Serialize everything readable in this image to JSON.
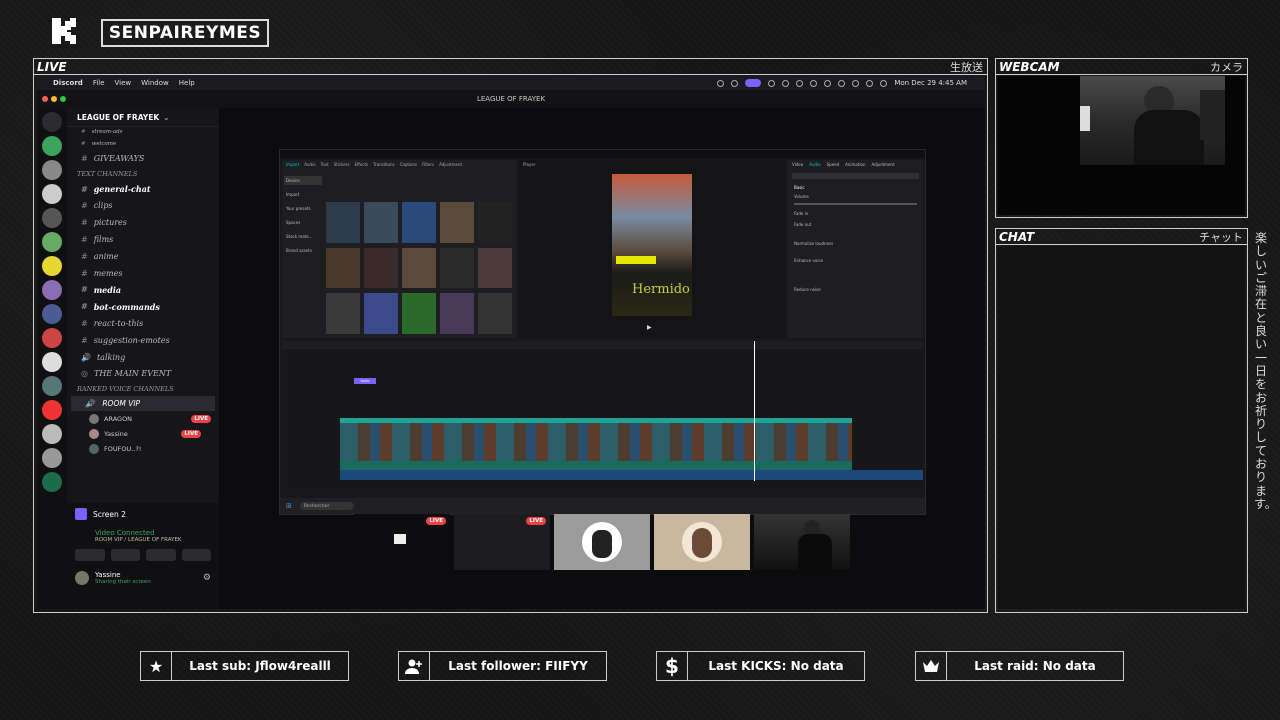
{
  "overlay": {
    "channel_name": "SENPAIREYMES",
    "live_label": "LIVE",
    "live_jp": "生放送",
    "webcam_label": "WEBCAM",
    "webcam_jp": "カメラ",
    "chat_label": "CHAT",
    "chat_jp": "チャット",
    "vertical_jp": "楽しいご滞在と良い一日をお祈りしております。"
  },
  "mac_menu": {
    "items": [
      "Discord",
      "File",
      "View",
      "Window",
      "Help"
    ],
    "clock": "Mon Dec 29  4:45 AM"
  },
  "discord": {
    "window_title": "LEAGUE OF FRAYEK",
    "server_name": "LEAGUE OF FRAYEK",
    "top_channels": [
      "stream-ads",
      "welcome",
      "GIVEAWAYS"
    ],
    "text_category": "TEXT CHANNELS",
    "text_channels": [
      {
        "name": "general-chat",
        "bold": true
      },
      {
        "name": "clips",
        "bold": false
      },
      {
        "name": "pictures",
        "bold": false
      },
      {
        "name": "films",
        "bold": false
      },
      {
        "name": "anime",
        "bold": false
      },
      {
        "name": "memes",
        "bold": false
      },
      {
        "name": "media",
        "bold": true
      },
      {
        "name": "bot-commands",
        "bold": true
      },
      {
        "name": "react-to-this",
        "bold": false
      },
      {
        "name": "suggestion-emotes",
        "bold": false
      },
      {
        "name": "talking",
        "bold": false
      },
      {
        "name": "THE MAIN EVENT",
        "bold": false
      }
    ],
    "voice_category": "RANKED VOICE CHANNELS",
    "voice_channel": "ROOM VIP",
    "voice_members": [
      {
        "name": "ARAGON",
        "live": true
      },
      {
        "name": "Yassine",
        "live": true
      },
      {
        "name": "FOUFOU..?!",
        "live": false
      }
    ],
    "live_badge": "LIVE",
    "screen_share_title": "Screen 2",
    "connection_status": "Video Connected",
    "connection_location": "ROOM VIP / LEAGUE OF FRAYEK",
    "user_name": "Yassine",
    "user_status": "Sharing their screen"
  },
  "editor": {
    "tabs": [
      "Import",
      "Audio",
      "Text",
      "Stickers",
      "Effects",
      "Transitions",
      "Captions",
      "Filters",
      "Adjustment"
    ],
    "side_items": [
      "Device",
      "Import",
      "Your presets",
      "Spaces",
      "Stock mate...",
      "Brand assets"
    ],
    "player_label": "Player",
    "right_tabs": [
      "Video",
      "Audio",
      "Speed",
      "Animation",
      "Adjustment"
    ],
    "basic_label": "Basic",
    "volume_label": "Volume",
    "fade_in_label": "Fade in",
    "fade_out_label": "Fade out",
    "normalize_label": "Normalize loudness",
    "enhance_label": "Enhance voice",
    "reduce_label": "Reduce noise",
    "player_caption": "Hermido",
    "timeline_text_label": "texto"
  },
  "taskbar": {
    "search_placeholder": "Rechercher"
  },
  "stats": {
    "last_sub": "Last sub: Jflow4realll",
    "last_follower": "Last follower: FIIFYY",
    "last_kicks": "Last KICKS: No data",
    "last_raid": "Last raid: No data"
  },
  "colors": {
    "accent_green": "#3ba55d",
    "live_red": "#ed4245",
    "timeline_teal": "#1fa394"
  }
}
